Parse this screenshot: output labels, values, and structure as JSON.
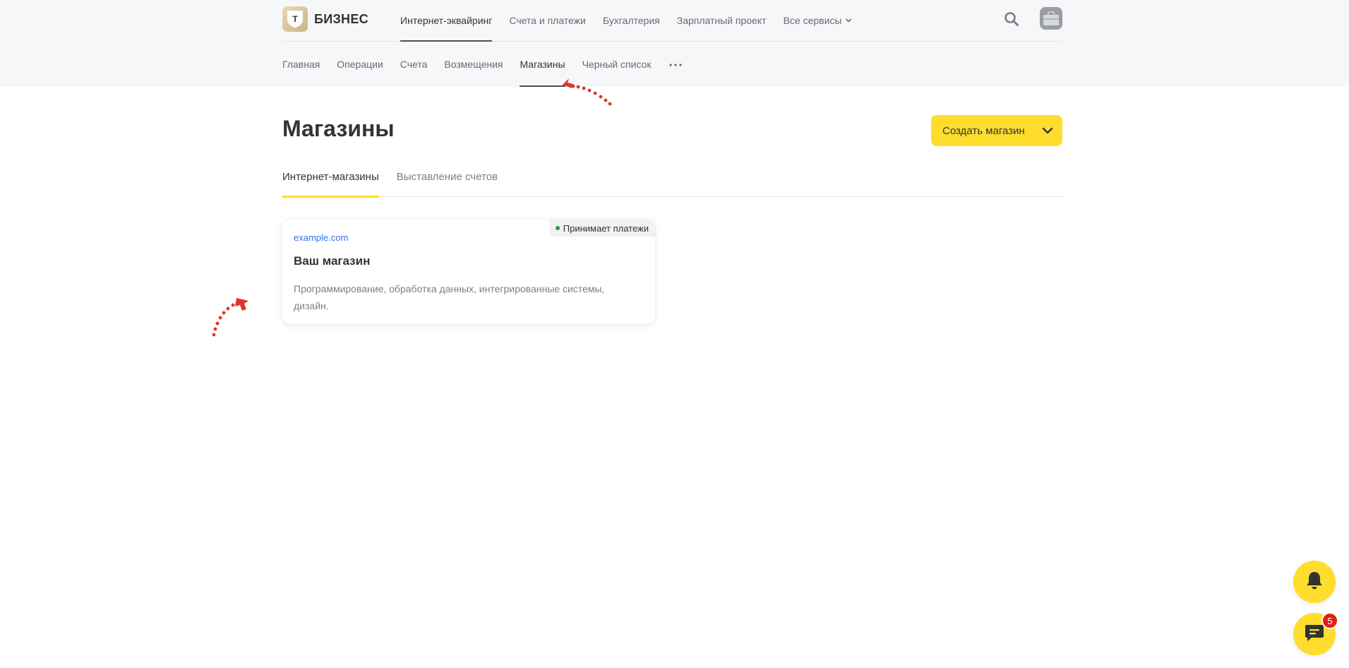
{
  "header": {
    "logo_text": "БИЗНЕС",
    "logo_letter": "Т",
    "top_nav": [
      {
        "label": "Интернет-эквайринг",
        "active": true
      },
      {
        "label": "Счета и платежи"
      },
      {
        "label": "Бухгалтерия"
      },
      {
        "label": "Зарплатный проект"
      },
      {
        "label": "Все сервисы"
      }
    ],
    "sub_nav": [
      {
        "label": "Главная"
      },
      {
        "label": "Операции"
      },
      {
        "label": "Счета"
      },
      {
        "label": "Возмещения"
      },
      {
        "label": "Магазины",
        "active": true
      },
      {
        "label": "Черный список"
      }
    ]
  },
  "main": {
    "title": "Магазины",
    "create_button_label": "Создать магазин",
    "tabs": [
      {
        "label": "Интернет-магазины",
        "active": true
      },
      {
        "label": "Выставление счетов"
      }
    ],
    "shop_card": {
      "status": "Принимает платежи",
      "url": "example.com",
      "name": "Ваш магазин",
      "description": "Программирование, обработка данных, интегрированные системы, дизайн."
    }
  },
  "floating": {
    "chat_unread_count": "5"
  },
  "colors": {
    "accent": "#ffdd2d",
    "link": "#336fee",
    "status_ok": "#21a038",
    "badge_red": "#dd2111",
    "annotation": "#e0352b"
  },
  "icons": {
    "search": "search-icon",
    "avatar": "briefcase-avatar-icon",
    "more": "more-dots-icon",
    "chevron": "chevron-down-icon",
    "bell": "bell-icon",
    "chat": "chat-icon"
  }
}
